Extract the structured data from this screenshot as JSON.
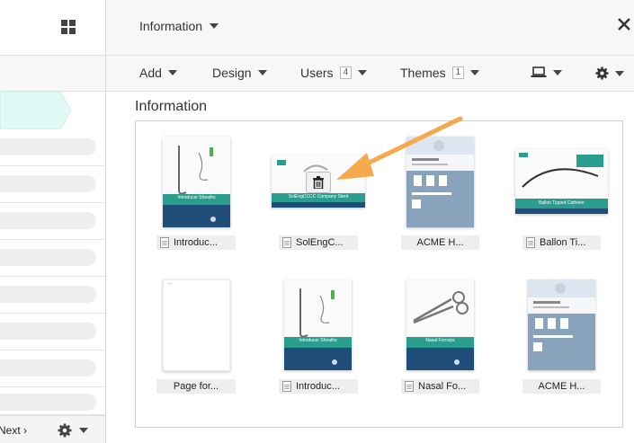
{
  "header": {
    "title": "Information"
  },
  "toolbar": {
    "add_label": "Add",
    "design_label": "Design",
    "users_label": "Users",
    "users_count": "4",
    "themes_label": "Themes",
    "themes_count": "1"
  },
  "sidebar": {
    "next_label": "Next ›"
  },
  "main": {
    "section_title": "Information",
    "items": [
      {
        "label": "Introduc...",
        "thumb_caption": "Introducer Sheaths"
      },
      {
        "label": "SolEngC...",
        "thumb_caption": "SolEngCCCC Company Stent"
      },
      {
        "label": "ACME H..."
      },
      {
        "label": "Ballon Ti...",
        "thumb_caption": "Ballon Tipped Catheter"
      },
      {
        "label": "Page for..."
      },
      {
        "label": "Introduc...",
        "thumb_caption": "Introducer Sheaths"
      },
      {
        "label": "Nasal Fo...",
        "thumb_caption": "Nasal Forceps"
      },
      {
        "label": "ACME H..."
      }
    ]
  },
  "colors": {
    "accent_teal": "#2a9d8f",
    "navy": "#1f4e79",
    "sidebar_active": "#dffaf5",
    "arrow": "#f5a94a"
  }
}
